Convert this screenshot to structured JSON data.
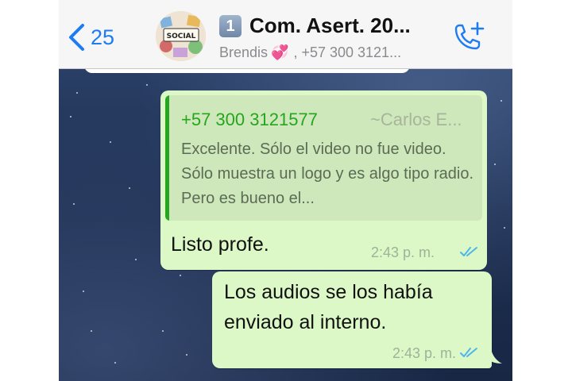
{
  "header": {
    "back_count": "25",
    "group_number_badge": "1",
    "group_title": "Com. Asert. 20...",
    "subtitle_name": "Brendis",
    "subtitle_heart": "💞",
    "subtitle_rest": ", +57 300 3121...",
    "avatar_label": "SOCIAL"
  },
  "messages": [
    {
      "quote": {
        "sender_phone": "+57 300 3121577",
        "sender_name": "~Carlos E...",
        "text": "Excelente. Sólo el video no fue video. Sólo muestra un logo y es algo tipo radio. Pero es bueno el..."
      },
      "text": "Listo profe.",
      "time": "2:43 p. m."
    },
    {
      "text": "Los audios se los había enviado al interno.",
      "time": "2:43 p. m."
    }
  ],
  "colors": {
    "accent_blue": "#1e7cf2",
    "outgoing_bubble": "#dcf8c6",
    "quote_green": "#25a61d",
    "read_ticks": "#4fb6ec"
  },
  "icons": {
    "back": "chevron-left-icon",
    "call": "add-call-icon",
    "read_receipt": "double-check-icon"
  }
}
